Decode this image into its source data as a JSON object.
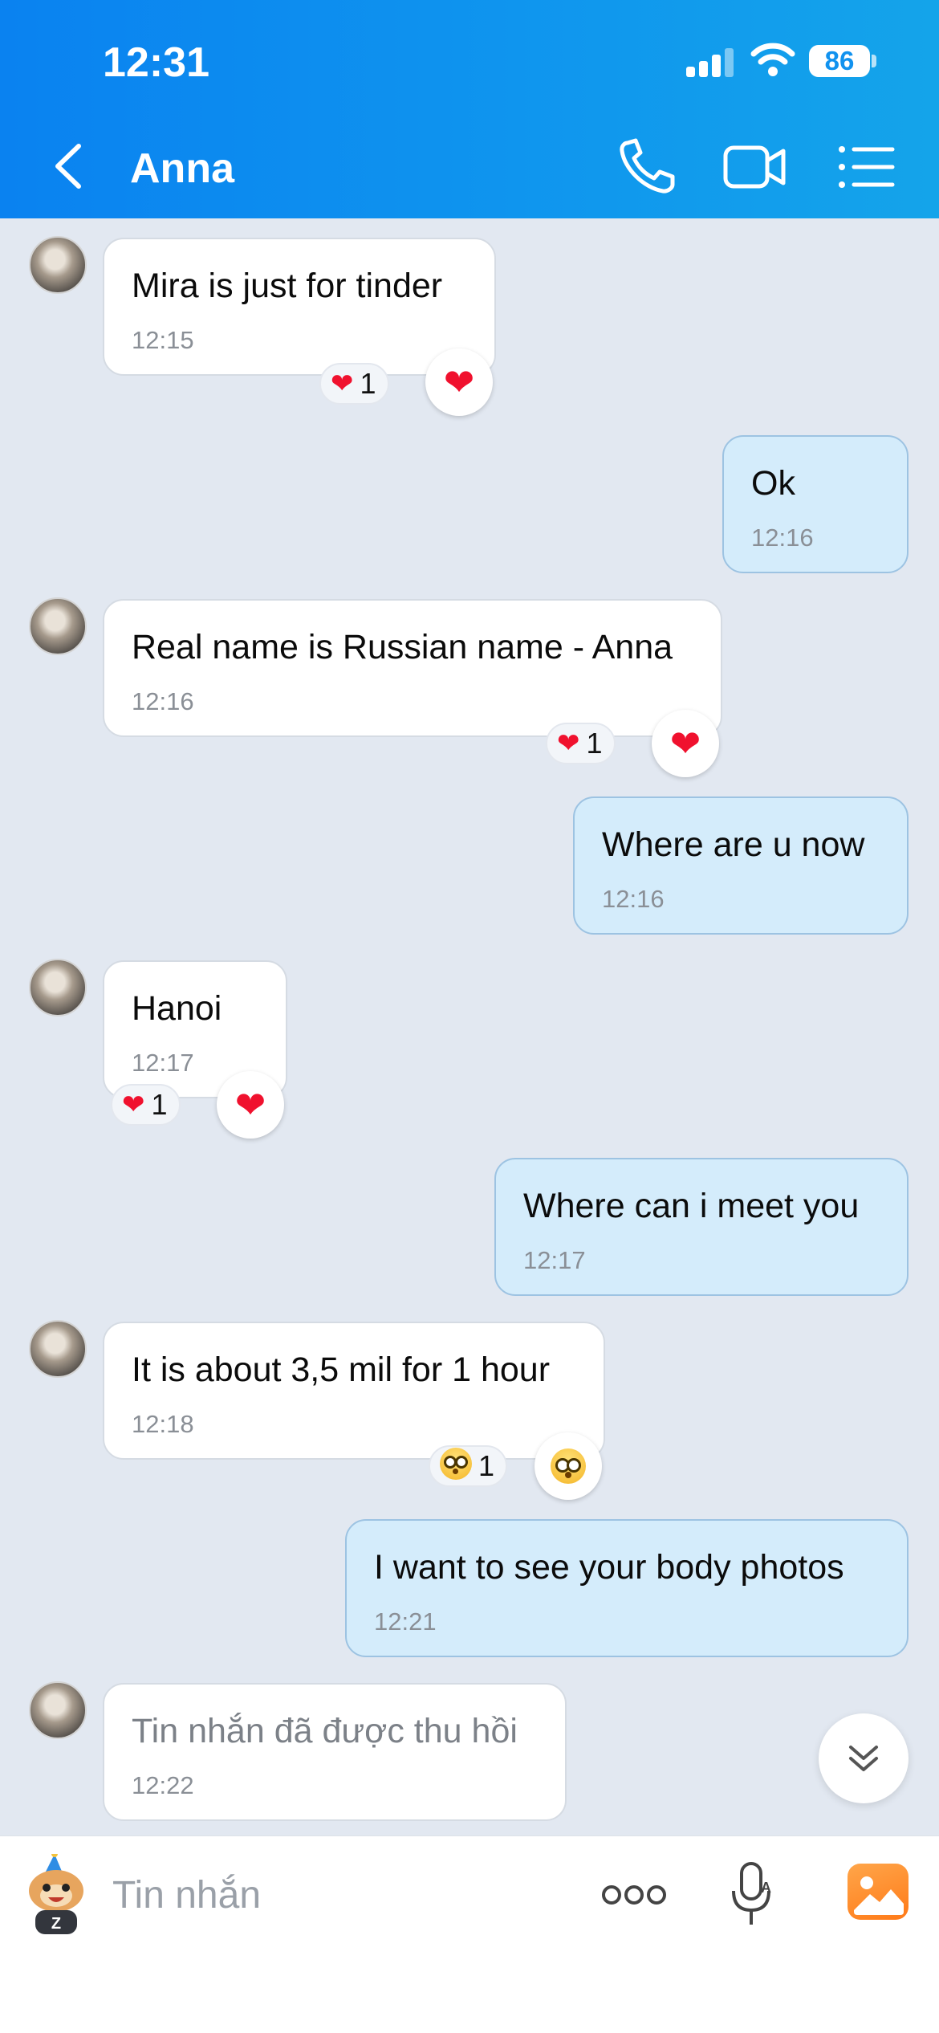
{
  "status_bar": {
    "time": "12:31",
    "battery": "86"
  },
  "header": {
    "contact_name": "Anna"
  },
  "messages": [
    {
      "text": "Mira is just for tinder",
      "time": "12:15",
      "reaction_count": "1"
    },
    {
      "text": "Ok",
      "time": "12:16"
    },
    {
      "text": "Real name is Russian name - Anna",
      "time": "12:16",
      "reaction_count": "1"
    },
    {
      "text": "Where are u now",
      "time": "12:16"
    },
    {
      "text": "Hanoi",
      "time": "12:17",
      "reaction_count": "1"
    },
    {
      "text": "Where can i meet you",
      "time": "12:17"
    },
    {
      "text": "It is about 3,5 mil for 1 hour",
      "time": "12:18",
      "reaction_count": "1"
    },
    {
      "text": "I want to see your body photos",
      "time": "12:21"
    },
    {
      "text": "Tin nhắn đã được thu hồi",
      "time": "12:22"
    }
  ],
  "input": {
    "placeholder": "Tin nhắn"
  },
  "colors": {
    "header_gradient_start": "#0a82f0",
    "header_gradient_end": "#14a4ea",
    "out_bubble": "#d4ecfb",
    "in_bubble": "#ffffff",
    "chat_bg": "#e2e8f1",
    "reaction_heart": "#f0112e",
    "image_button": "#ff8a2a"
  },
  "icons": [
    "back-icon",
    "phone-icon",
    "video-call-icon",
    "menu-list-icon",
    "heart-icon",
    "flushed-face-icon",
    "chevrons-down-icon",
    "sticker-icon",
    "more-icon",
    "voice-mic-icon",
    "image-icon"
  ]
}
